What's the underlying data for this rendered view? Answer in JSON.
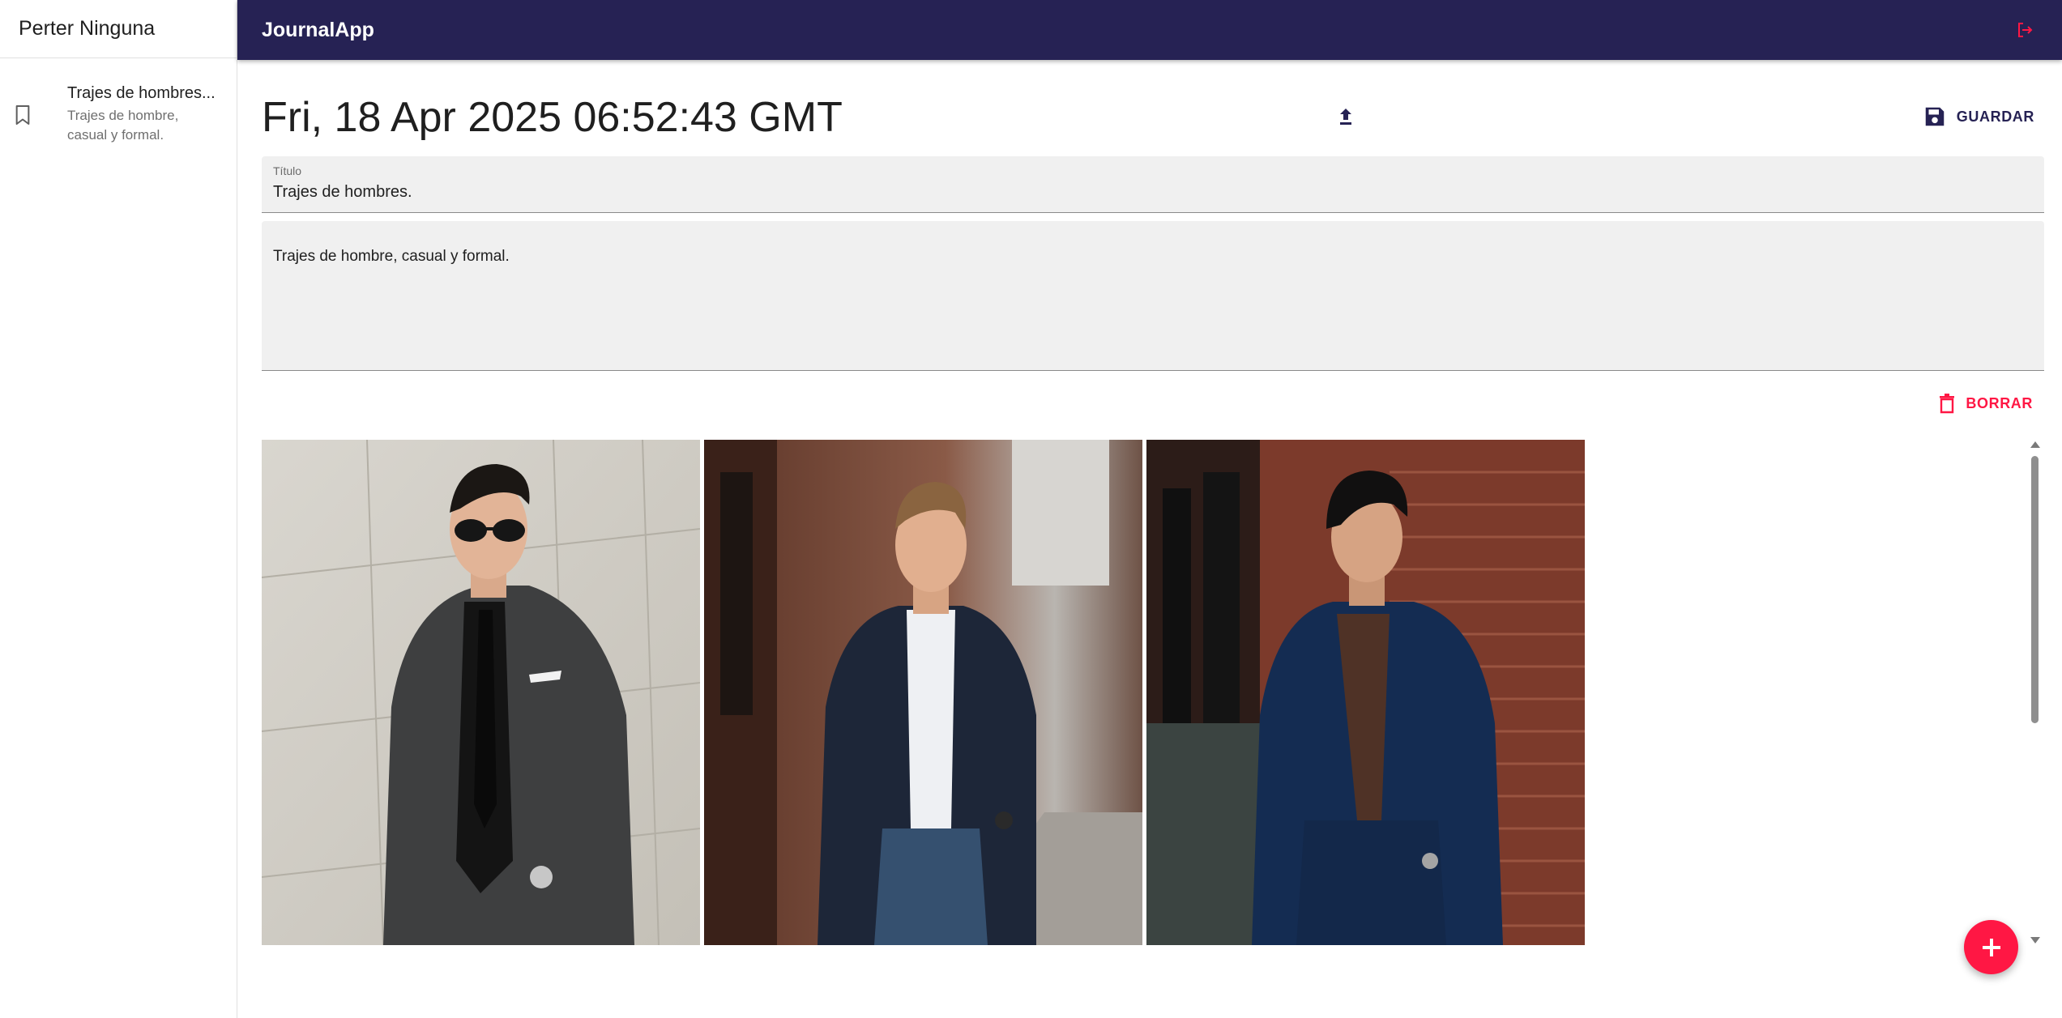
{
  "sidebar": {
    "user_name": "Perter Ninguna",
    "entries": [
      {
        "title": "Trajes de hombres...",
        "body": "Trajes de hombre, casual y formal.",
        "icon": "bookmark-icon"
      }
    ]
  },
  "appbar": {
    "title": "JournalApp",
    "logout_icon": "logout-icon"
  },
  "note": {
    "date": "Fri, 18 Apr 2025 06:52:43 GMT",
    "upload_icon": "upload-icon",
    "save_label": "GUARDAR",
    "title_field": {
      "label": "Título",
      "value": "Trajes de hombres."
    },
    "body_field": {
      "value": "Trajes de hombre, casual y formal."
    },
    "delete_label": "BORRAR",
    "images": [
      {
        "name": "man-gray-suit-sunglasses"
      },
      {
        "name": "man-navy-blazer-white-shirt-jeans"
      },
      {
        "name": "man-navy-suit-brown-shirt"
      }
    ]
  },
  "fab": {
    "icon": "plus-icon"
  },
  "colors": {
    "appbar": "#262254",
    "accent": "#ff1744",
    "primary": "#262254",
    "field_bg": "#f0f0f0"
  }
}
